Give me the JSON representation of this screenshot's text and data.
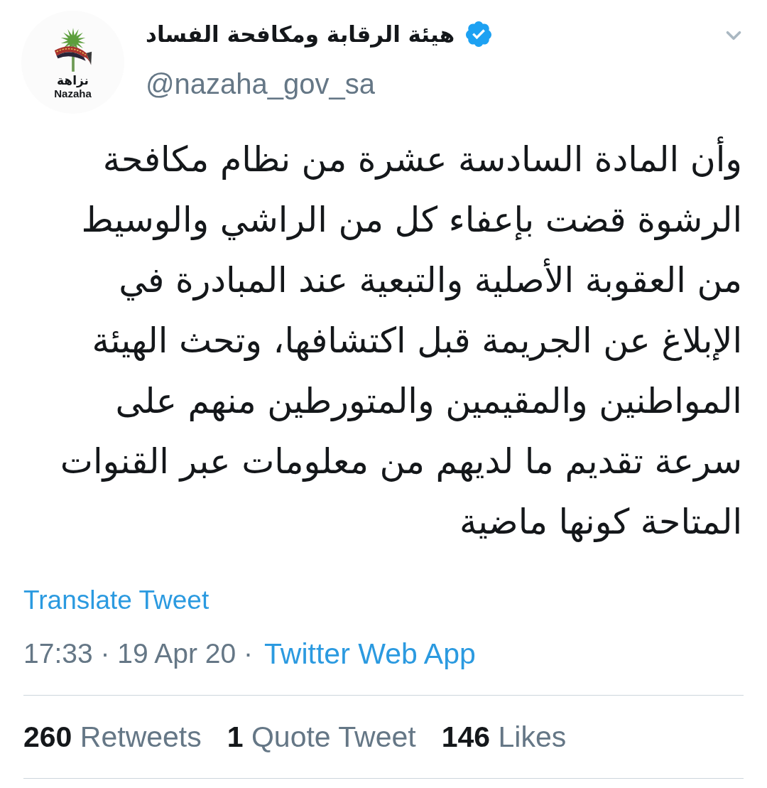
{
  "tweet": {
    "author": {
      "name": "هيئة الرقابة ومكافحة الفساد",
      "verified": true,
      "handle": "@nazaha_gov_sa",
      "avatar": {
        "logo_text": "نزاهة",
        "logo_subtext": "Nazaha"
      }
    },
    "text": "وأن المادة السادسة عشرة من نظام مكافحة\nالرشوة قضت بإعفاء كل من الراشي والوسيط\nمن العقوبة الأصلية والتبعية عند المبادرة في\nالإبلاغ عن الجريمة قبل اكتشافها، وتحث الهيئة\nالمواطنين والمقيمين والمتورطين منهم على\nسرعة تقديم ما لديهم من معلومات عبر القنوات\nالمتاحة كونها ماضية",
    "translate_link": "Translate Tweet",
    "timestamp": "17:33 · 19 Apr 20 ·",
    "source": "Twitter Web App",
    "stats": {
      "retweets": {
        "count": "260",
        "label": "Retweets"
      },
      "quote_tweets": {
        "count": "1",
        "label": "Quote Tweet"
      },
      "likes": {
        "count": "146",
        "label": "Likes"
      }
    }
  }
}
